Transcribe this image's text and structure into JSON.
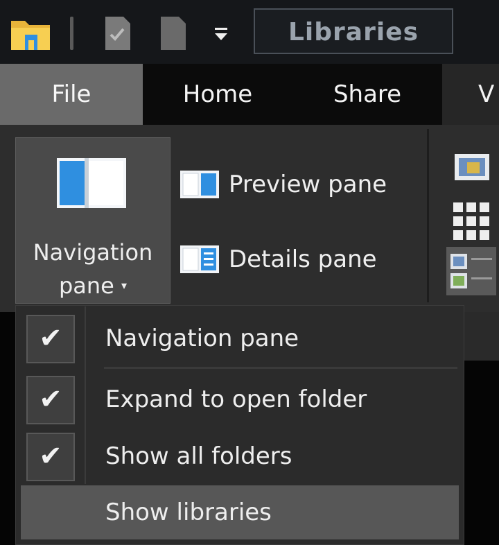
{
  "window": {
    "title": "Libraries"
  },
  "quick_access": {
    "icons": [
      "folder-icon",
      "properties-icon",
      "new-folder-icon",
      "customize-dropdown-icon"
    ]
  },
  "tabs": [
    {
      "label": "File"
    },
    {
      "label": "Home"
    },
    {
      "label": "Share"
    },
    {
      "label": "V"
    }
  ],
  "ribbon": {
    "navigation_pane": {
      "label_line1": "Navigation",
      "label_line2": "pane",
      "caret": "▾"
    },
    "preview_pane": {
      "label": "Preview pane"
    },
    "details_pane": {
      "label": "Details pane"
    }
  },
  "menu": {
    "items": [
      {
        "label": "Navigation pane",
        "checked": true
      },
      {
        "label": "Expand to open folder",
        "checked": true
      },
      {
        "label": "Show all folders",
        "checked": true
      },
      {
        "label": "Show libraries",
        "checked": false
      }
    ],
    "check_glyph": "✔"
  },
  "colors": {
    "accent_blue": "#2f8fe0",
    "folder_yellow": "#f5c542",
    "menu_hover": "#575757"
  }
}
